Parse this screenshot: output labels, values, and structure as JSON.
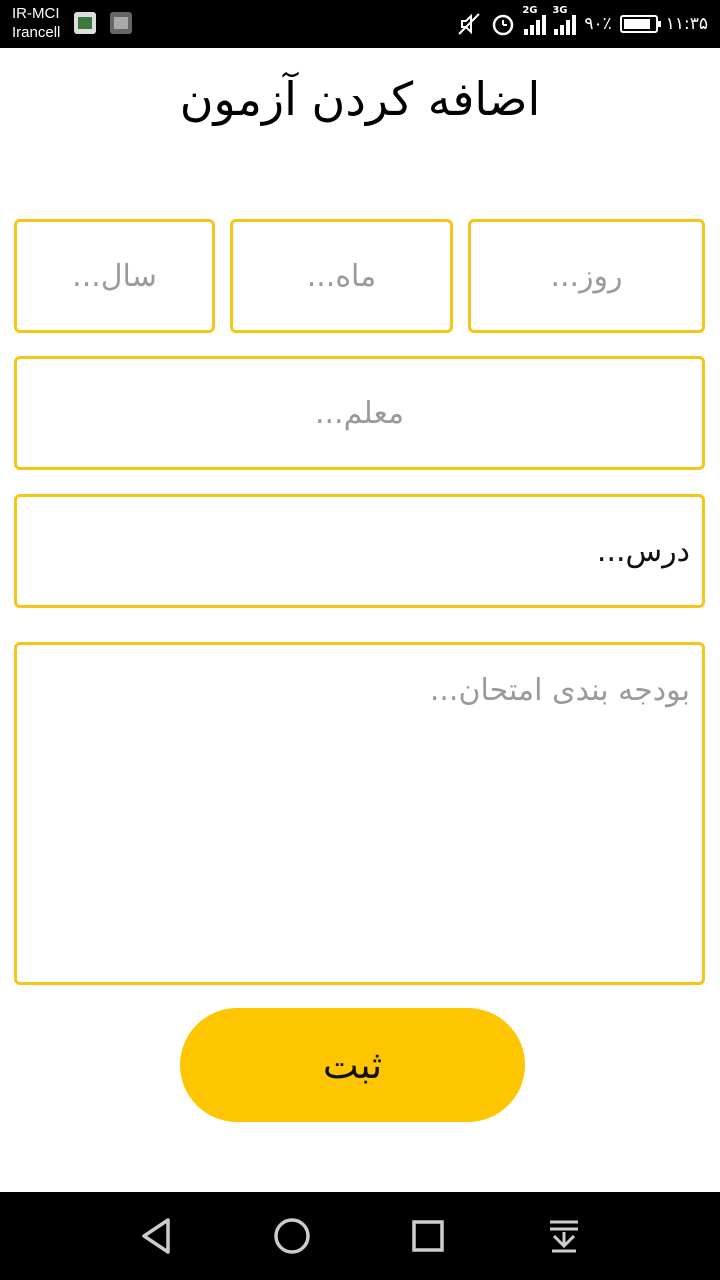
{
  "status_bar": {
    "carrier_1": "IR-MCI",
    "carrier_2": "Irancell",
    "network_1": "2G",
    "network_2": "3G",
    "battery": "۹۰٪",
    "time": "۱۱:۳۵"
  },
  "page": {
    "title": "اضافه کردن آزمون"
  },
  "form": {
    "day_placeholder": "روز...",
    "month_placeholder": "ماه...",
    "year_placeholder": "سال...",
    "teacher_placeholder": "معلم...",
    "lesson_value": "درس...",
    "budget_placeholder": "بودجه بندی امتحان...",
    "submit_label": "ثبت"
  },
  "colors": {
    "accent": "#fec601",
    "border": "#f5c518"
  },
  "icons": {
    "nav_back": "back-triangle-icon",
    "nav_home": "home-circle-icon",
    "nav_recents": "recents-square-icon",
    "nav_notifications": "notification-shade-icon"
  }
}
